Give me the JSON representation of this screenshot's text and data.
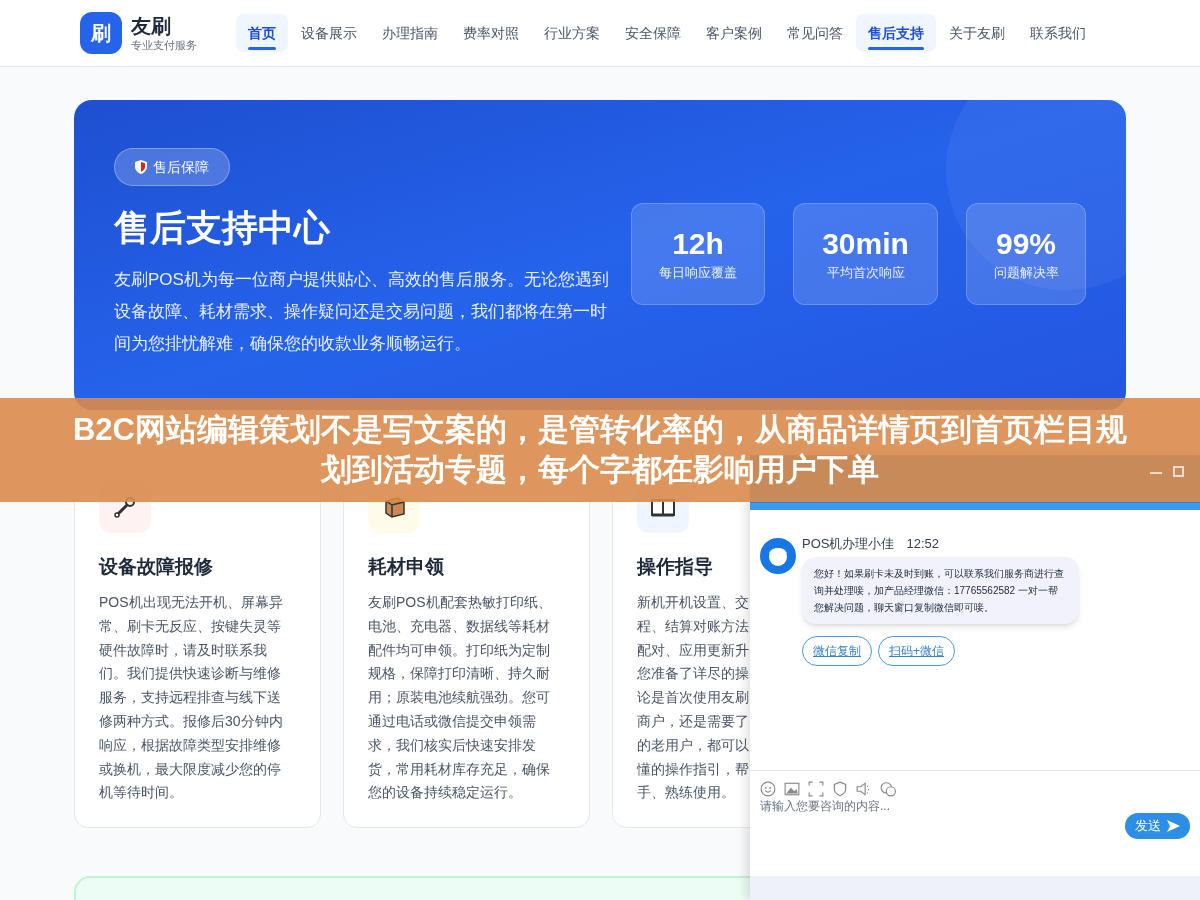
{
  "header": {
    "logo_mark": "刷",
    "brand": "友刷",
    "tagline": "专业支付服务",
    "nav": [
      {
        "label": "首页",
        "selected": true,
        "highlighted": true
      },
      {
        "label": "设备展示",
        "selected": false,
        "highlighted": false
      },
      {
        "label": "办理指南",
        "selected": false,
        "highlighted": false
      },
      {
        "label": "费率对照",
        "selected": false,
        "highlighted": false
      },
      {
        "label": "行业方案",
        "selected": false,
        "highlighted": false
      },
      {
        "label": "安全保障",
        "selected": false,
        "highlighted": false
      },
      {
        "label": "客户案例",
        "selected": false,
        "highlighted": false
      },
      {
        "label": "常见问答",
        "selected": false,
        "highlighted": false
      },
      {
        "label": "售后支持",
        "selected": true,
        "highlighted": true
      },
      {
        "label": "关于友刷",
        "selected": false,
        "highlighted": false
      },
      {
        "label": "联系我们",
        "selected": false,
        "highlighted": false
      }
    ]
  },
  "hero": {
    "badge": "售后保障",
    "title": "售后支持中心",
    "description": "友刷POS机为每一位商户提供贴心、高效的售后服务。无论您遇到设备故障、耗材需求、操作疑问还是交易问题，我们都将在第一时间为您排忧解难，确保您的收款业务顺畅运行。",
    "stats": [
      {
        "value": "12h",
        "label": "每日响应覆盖"
      },
      {
        "value": "30min",
        "label": "平均首次响应"
      },
      {
        "value": "99%",
        "label": "问题解决率"
      }
    ]
  },
  "services": [
    {
      "kind": "wrench",
      "title": "设备故障报修",
      "lines": [
        "POS机出现无法开机、屏幕异",
        "常、刷卡无反应、按键失灵等",
        "硬件故障时，请及时联系我",
        "们。我们提供快速诊断与维修",
        "服务，支持远程排查与线下送",
        "修两种方式。报修后30分钟内",
        "响应，根据故障类型安排维修",
        "或换机，最大限度减少您的停",
        "机等待时间。"
      ]
    },
    {
      "kind": "box",
      "title": "耗材申领",
      "lines": [
        "友刷POS机配套热敏打印纸、",
        "电池、充电器、数据线等耗材",
        "配件均可申领。打印纸为定制",
        "规格，保障打印清晰、持久耐",
        "用；原装电池续航强劲。您可",
        "通过电话或微信提交申领需",
        "求，我们核实后快速安排发",
        "货，常用耗材库存充足，确保",
        "您的设备持续稳定运行。"
      ]
    },
    {
      "kind": "book",
      "title": "操作指导",
      "lines": [
        "新机开机设置、交",
        "程、结算对账方法",
        "配对、应用更新升",
        "您准备了详尽的操",
        "论是首次使用友刷",
        "商户，还是需要了",
        "的老用户，都可以",
        "懂的操作指引，帮",
        "手、熟练使用。"
      ]
    }
  ],
  "chat": {
    "sender": "POS机办理小佳",
    "time": "12:52",
    "message": "您好！如果刷卡未及时到账，可以联系我们服务商进行查询并处理唼，加产品经理微信：17765562582 一对一帮您解决问题，聊天窗口复制微信即可唼。",
    "actions": [
      "微信复制",
      "扫码+微信"
    ],
    "placeholder": "请输入您要咨询的内容...",
    "send": "发送"
  },
  "overlay_banner": "B2C网站编辑策划不是写文案的，是管转化率的，从商品详情页到首页栏目规划到活动专题，每个字都在影响用户下单"
}
